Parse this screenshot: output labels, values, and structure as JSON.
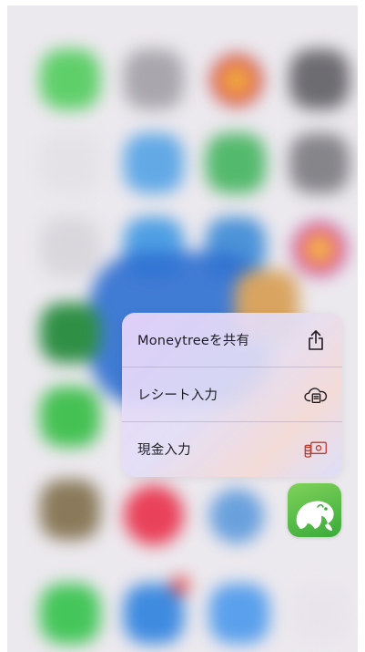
{
  "context_menu": {
    "items": [
      {
        "label": "Moneytreeを共有",
        "icon": "share-icon"
      },
      {
        "label": "レシート入力",
        "icon": "cloud-receipt-icon"
      },
      {
        "label": "現金入力",
        "icon": "cash-register-icon"
      }
    ]
  },
  "app": {
    "name": "Moneytree",
    "icon": "elephant-icon",
    "icon_color": "#4cb843"
  },
  "colors": {
    "accent_red": "#c0392b",
    "menu_text": "#1c1c22"
  }
}
